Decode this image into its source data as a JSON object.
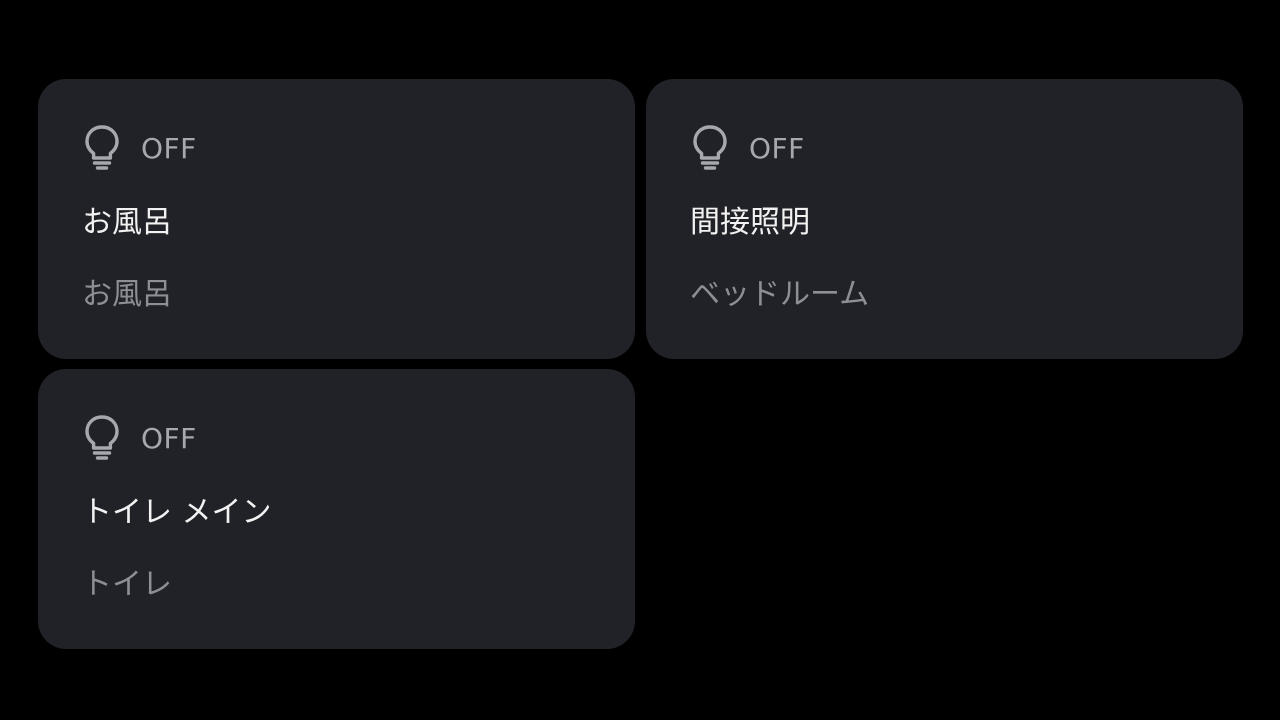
{
  "colors": {
    "background": "#000000",
    "tile": "#212227",
    "primary_text": "#f2f2f2",
    "secondary_text": "#8d8f94",
    "state_text": "#a6a8ad",
    "icon": "#a6a8ad"
  },
  "tiles": [
    {
      "icon": "lightbulb-icon",
      "state": "OFF",
      "name": "お風呂",
      "room": "お風呂"
    },
    {
      "icon": "lightbulb-icon",
      "state": "OFF",
      "name": "間接照明",
      "room": "ベッドルーム"
    },
    {
      "icon": "lightbulb-icon",
      "state": "OFF",
      "name": "トイレ メイン",
      "room": "トイレ"
    }
  ]
}
